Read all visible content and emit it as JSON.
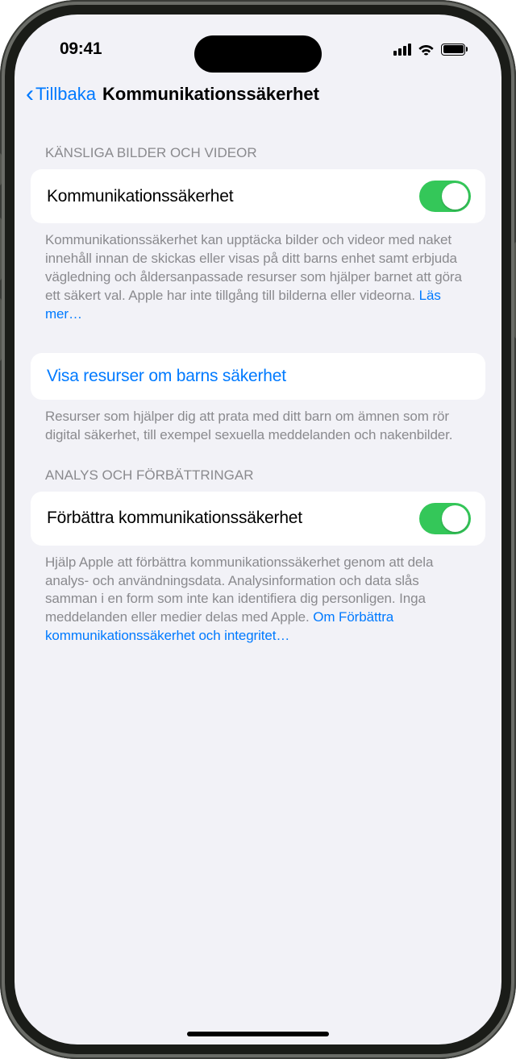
{
  "statusBar": {
    "time": "09:41"
  },
  "nav": {
    "back": "Tillbaka",
    "title": "Kommunikationssäkerhet"
  },
  "section1": {
    "header": "KÄNSLIGA BILDER OCH VIDEOR",
    "toggleLabel": "Kommunikationssäkerhet",
    "footerText": "Kommunikationssäkerhet kan upptäcka bilder och videor med naket innehåll innan de skickas eller visas på ditt barns enhet samt erbjuda vägledning och åldersanpassade resurser som hjälper barnet att göra ett säkert val. Apple har inte tillgång till bilderna eller videorna. ",
    "footerLink": "Läs mer…"
  },
  "section2": {
    "linkLabel": "Visa resurser om barns säkerhet",
    "footerText": "Resurser som hjälper dig att prata med ditt barn om ämnen som rör digital säkerhet, till exempel sexuella meddelanden och nakenbilder."
  },
  "section3": {
    "header": "ANALYS OCH FÖRBÄTTRINGAR",
    "toggleLabel": "Förbättra kommunikationssäkerhet",
    "footerText": "Hjälp Apple att förbättra kommunikationssäkerhet genom att dela analys- och användningsdata. Analysinformation och data slås samman i en form som inte kan identifiera dig personligen. Inga meddelanden eller medier delas med Apple. ",
    "footerLink": "Om Förbättra kommunikationssäkerhet och integritet…"
  }
}
